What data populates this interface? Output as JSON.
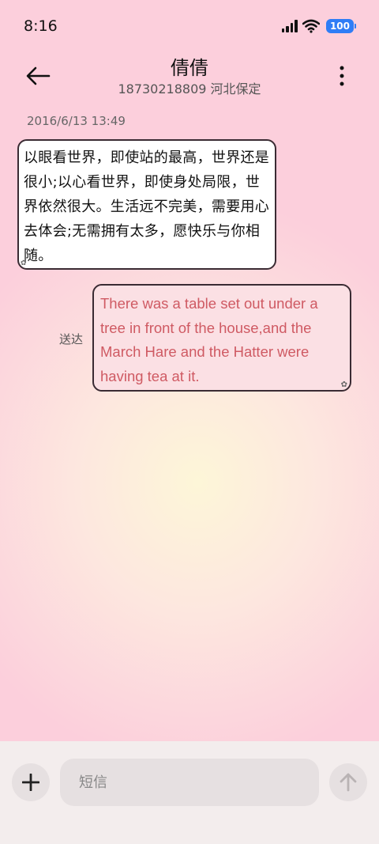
{
  "status_bar": {
    "time": "8:16",
    "battery": "100",
    "icons": [
      "signal-icon",
      "wifi-icon",
      "battery-icon"
    ]
  },
  "header": {
    "contact_name": "倩倩",
    "contact_detail": "18730218809 河北保定",
    "back_icon": "back-arrow-icon",
    "more_icon": "more-vertical-icon"
  },
  "conversation": {
    "timestamp": "2016/6/13 13:49",
    "incoming_message": "以眼看世界，即使站的最高，世界还是很小;以心看世界，即使身处局限，世界依然很大。生活远不完美，需要用心去体会;无需拥有太多，愿快乐与你相随。",
    "outgoing_message": "There was a table set out under a tree in front of the house,and the March Hare and the Hatter were having tea at it.",
    "outgoing_status": "送达"
  },
  "composer": {
    "placeholder": "短信",
    "add_icon": "plus-icon",
    "send_icon": "send-arrow-icon"
  },
  "colors": {
    "background": "#fccfdc",
    "incoming_bubble": "#ffffff",
    "outgoing_bubble": "#fbe0e4",
    "outgoing_text": "#cf5a63",
    "battery": "#2f7df6"
  }
}
